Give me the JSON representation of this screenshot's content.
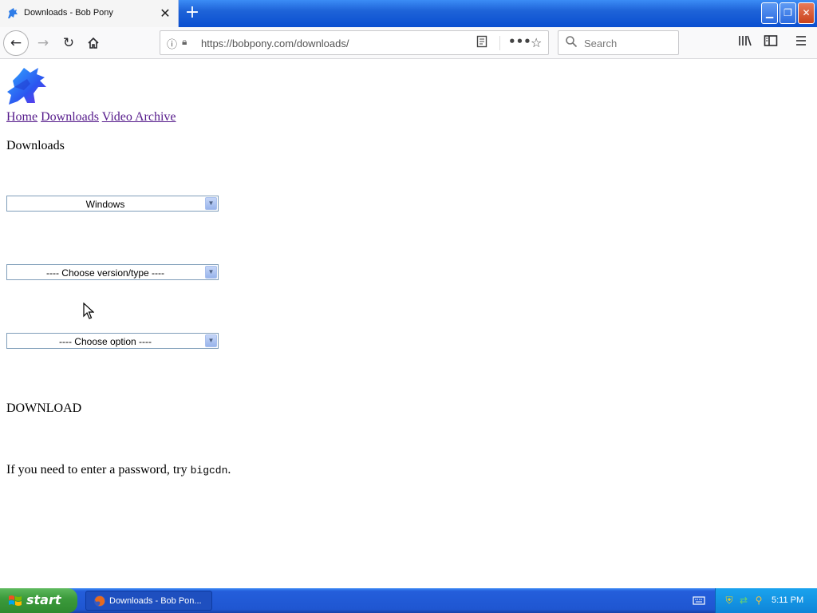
{
  "browser": {
    "tab_title": "Downloads - Bob Pony",
    "tab_close": "✕",
    "new_tab": "+",
    "url": "https://bobpony.com/downloads/",
    "search_placeholder": "Search",
    "window_controls": {
      "minimize": "▁",
      "maximize": "❐",
      "close": "✕"
    },
    "icons": {
      "back": "back-arrow-icon",
      "forward": "forward-arrow-icon",
      "reload": "reload-icon",
      "home": "home-icon",
      "info": "info-icon",
      "lock": "warning-lock-icon",
      "reader": "reader-view-icon",
      "more": "page-actions-icon",
      "bookmark": "star-icon",
      "search": "search-icon",
      "library": "library-icon",
      "sidebar": "sidebar-icon",
      "menu": "hamburger-menu-icon"
    }
  },
  "page": {
    "nav": [
      {
        "label": "Home"
      },
      {
        "label": "Downloads"
      },
      {
        "label": "Video Archive"
      }
    ],
    "heading": "Downloads",
    "selects": {
      "os": "Windows",
      "version": "---- Choose version/type ----",
      "option": "---- Choose option ----"
    },
    "download_label": "DOWNLOAD",
    "password_prefix": "If you need to enter a password, try ",
    "password_code": "bigcdn",
    "password_suffix": "."
  },
  "taskbar": {
    "start_label": "start",
    "task_label": "Downloads - Bob Pon...",
    "clock": "5:11 PM"
  },
  "colors": {
    "link": "#1a0dab",
    "visited_link": "#551a8b",
    "xp_blue": "#245edb",
    "start_green": "#3c9b3c",
    "tray_blue": "#0f85d8"
  }
}
